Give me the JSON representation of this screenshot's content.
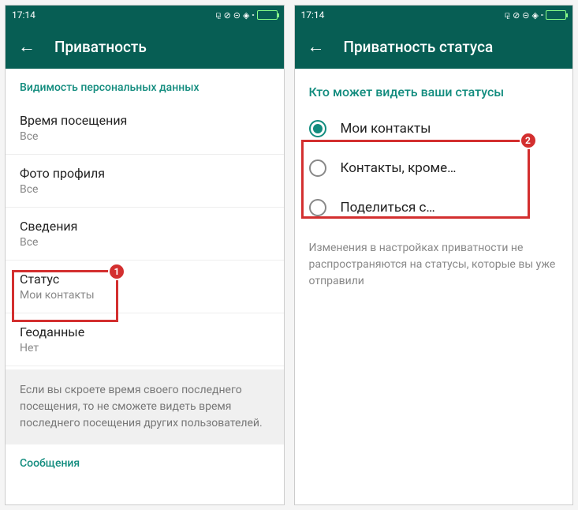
{
  "status": {
    "time": "17:14"
  },
  "screen1": {
    "title": "Приватность",
    "section_header": "Видимость персональных данных",
    "items": [
      {
        "title": "Время посещения",
        "value": "Все"
      },
      {
        "title": "Фото профиля",
        "value": "Все"
      },
      {
        "title": "Сведения",
        "value": "Все"
      },
      {
        "title": "Статус",
        "value": "Мои контакты"
      },
      {
        "title": "Геоданные",
        "value": "Нет"
      }
    ],
    "info": "Если вы скроете время своего последнего посещения, то не сможете видеть время последнего посещения других пользователей.",
    "next_section": "Сообщения",
    "badge": "1"
  },
  "screen2": {
    "title": "Приватность статуса",
    "section_header": "Кто может видеть ваши статусы",
    "options": [
      {
        "label": "Мои контакты",
        "selected": true
      },
      {
        "label": "Контакты, кроме…",
        "selected": false
      },
      {
        "label": "Поделиться с…",
        "selected": false
      }
    ],
    "note": "Изменения в настройках приватности не распространяются на статусы, которые вы уже отправили",
    "badge": "2"
  }
}
